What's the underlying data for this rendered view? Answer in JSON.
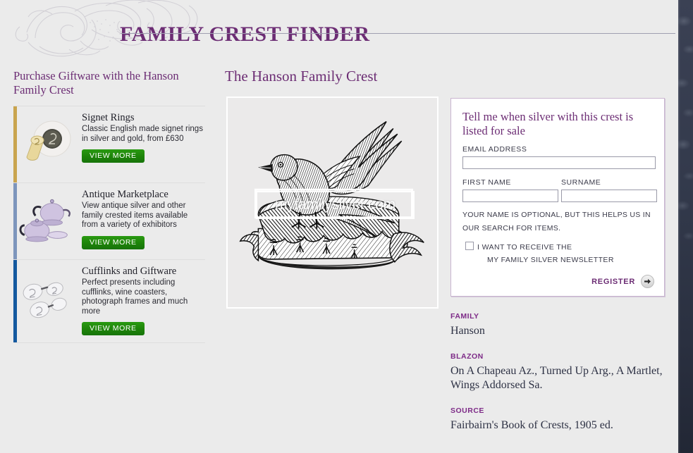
{
  "header": {
    "site_title": "FAMILY CREST FINDER",
    "flourish_icon": "heraldic-flourish-icon"
  },
  "sidebar": {
    "heading": "Purchase Giftware with the Hanson Family Crest",
    "items": [
      {
        "title": "Signet Rings",
        "description": "Classic English made signet rings in silver and gold, from £630",
        "button_label": "VIEW MORE",
        "accent_color": "#c9a44e",
        "thumb_icon": "signet-ring-thumbnail"
      },
      {
        "title": "Antique Marketplace",
        "description": "View antique silver and other family crested items available from a variety of exhibitors",
        "button_label": "VIEW MORE",
        "accent_color": "#7d95bc",
        "thumb_icon": "silver-teapot-thumbnail"
      },
      {
        "title": "Cufflinks and Giftware",
        "description": "Perfect presents including cufflinks, wine coasters, photograph frames and much more",
        "button_label": "VIEW MORE",
        "accent_color": "#14599f",
        "thumb_icon": "cufflinks-thumbnail"
      }
    ]
  },
  "crest": {
    "heading": "The Hanson Family Crest",
    "watermark": "myfamilysilver.com",
    "image_alt": "martlet-on-chapeau-crest-engraving"
  },
  "signup": {
    "title": "Tell me when silver with this crest is listed for sale",
    "email_label": "EMAIL ADDRESS",
    "email_value": "",
    "email_placeholder": "",
    "first_name_label": "FIRST NAME",
    "first_name_value": "",
    "first_name_placeholder": "",
    "surname_label": "SURNAME",
    "surname_value": "",
    "surname_placeholder": "",
    "optional_note": "YOUR NAME IS OPTIONAL, BUT THIS HELPS US IN OUR SEARCH FOR ITEMS.",
    "newsletter_line1": "I WANT TO RECEIVE THE",
    "newsletter_line2": "MY FAMILY SILVER NEWSLETTER",
    "newsletter_checked": false,
    "register_label": "REGISTER",
    "register_arrow_icon": "arrow-right-icon"
  },
  "details": [
    {
      "label": "FAMILY",
      "value": "Hanson"
    },
    {
      "label": "BLAZON",
      "value": "On A Chapeau Az., Turned Up Arg., A Martlet, Wings Addorsed Sa."
    },
    {
      "label": "SOURCE",
      "value": "Fairbairn's Book of Crests, 1905 ed."
    }
  ],
  "colors": {
    "brand_purple": "#6c2d74",
    "page_background": "#ebebeb",
    "button_green": "#1d8309",
    "detail_label_purple": "#7d2a87"
  }
}
